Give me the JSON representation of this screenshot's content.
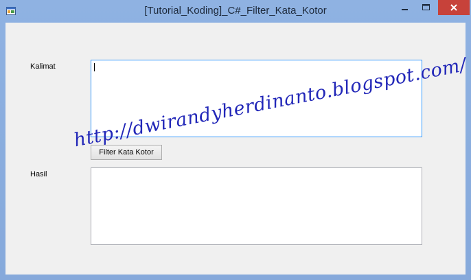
{
  "window": {
    "title": "[Tutorial_Koding]_C#_Filter_Kata_Kotor",
    "icons": {
      "app": "app-window-icon",
      "minimize": "minimize-icon",
      "maximize": "maximize-icon",
      "close": "close-icon"
    },
    "close_color": "#c7423a"
  },
  "form": {
    "kalimat_label": "Kalimat",
    "kalimat_value": "",
    "filter_button_label": "Filter Kata Kotor",
    "hasil_label": "Hasil",
    "hasil_value": ""
  },
  "watermark": {
    "text": "http://dwirandyherdinanto.blogspot.com/",
    "color": "#2227b8"
  }
}
